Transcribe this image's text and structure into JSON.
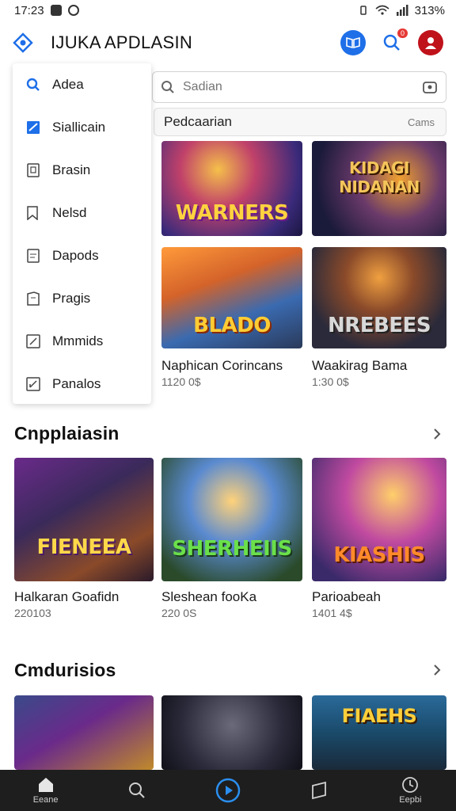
{
  "status": {
    "time": "17:23",
    "battery": "313%"
  },
  "app": {
    "title": "IJUKA APDLASIN",
    "badge": "0"
  },
  "menu": {
    "items": [
      {
        "label": "Adea",
        "icon": "search-icon"
      },
      {
        "label": "Siallicain",
        "icon": "checkbox-icon"
      },
      {
        "label": "Brasin",
        "icon": "book-icon"
      },
      {
        "label": "Nelsd",
        "icon": "bookmark-icon"
      },
      {
        "label": "Dapods",
        "icon": "note-icon"
      },
      {
        "label": "Pragis",
        "icon": "doc-icon"
      },
      {
        "label": "Mmmids",
        "icon": "edit-icon"
      },
      {
        "label": "Panalos",
        "icon": "edit-icon"
      }
    ]
  },
  "search": {
    "placeholder": "Sadian"
  },
  "filter": {
    "label": "Pedcaarian",
    "sort": "Cams"
  },
  "top_games": [
    {
      "art": "WARNERS"
    },
    {
      "art": "KIDAGI NIDANAN"
    },
    {
      "art": "BLADO",
      "caption": "Naphican Corincans",
      "price": "1120 0$"
    },
    {
      "art": "NREBEES",
      "caption": "Waakirag Bama",
      "price": "1:30 0$"
    }
  ],
  "section1": {
    "title": "Cnpplaiasin",
    "items": [
      {
        "art": "FIENEEA",
        "caption": "Halkaran Goafidn",
        "price": "220103"
      },
      {
        "art": "SHERHEIIS",
        "caption": "Sleshean fooKa",
        "price": "220 0S"
      },
      {
        "art": "KIASHIS",
        "caption": "Parioabeah",
        "price": "1401 4$"
      }
    ]
  },
  "section2": {
    "title": "Cmdurisios",
    "items": [
      {
        "art": ""
      },
      {
        "art": ""
      },
      {
        "art": "FIAEHS"
      }
    ]
  },
  "nav": [
    {
      "label": "Eeane",
      "icon": "home-icon"
    },
    {
      "label": "",
      "icon": "search-icon"
    },
    {
      "label": "",
      "icon": "play-icon"
    },
    {
      "label": "",
      "icon": "bookmark-icon"
    },
    {
      "label": "Eepbi",
      "icon": "clock-icon"
    }
  ],
  "colors": {
    "accent": "#1e6fe8",
    "danger": "#c0121b",
    "nav_bg": "#1e1e1e"
  }
}
